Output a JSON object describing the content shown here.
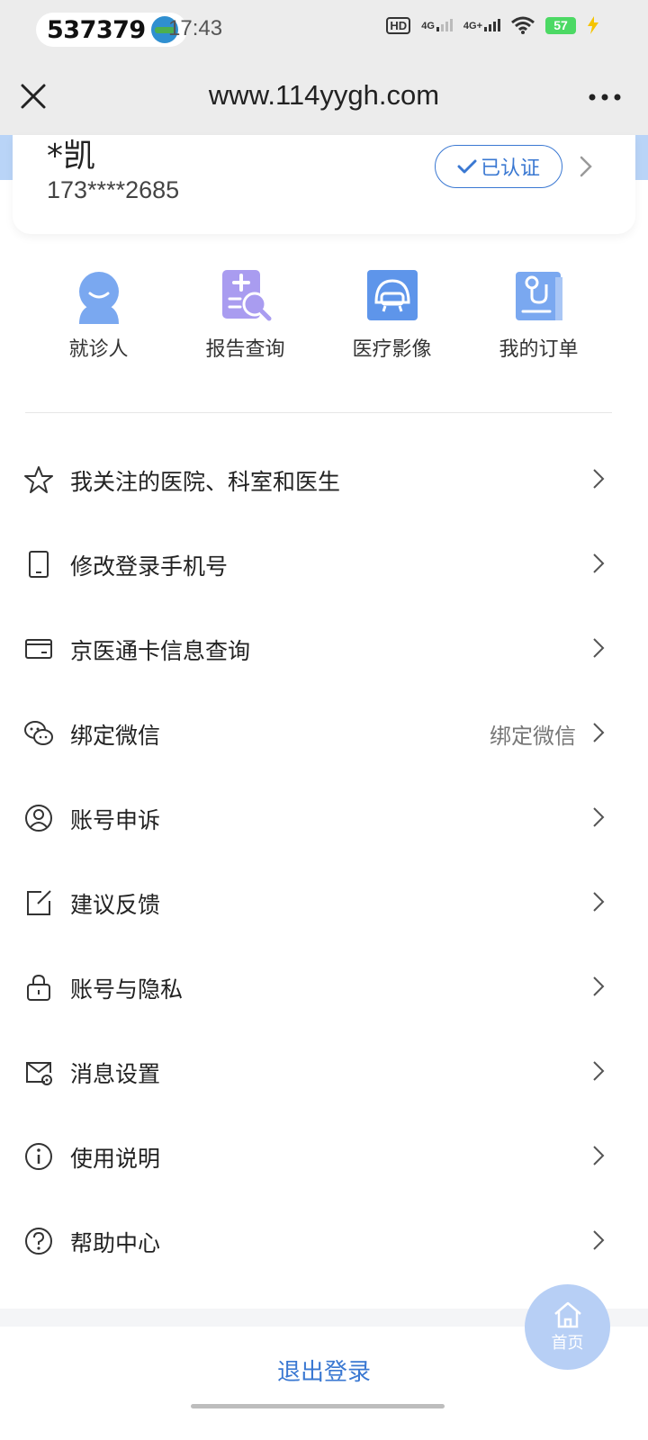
{
  "status_bar": {
    "code": "537379",
    "time": "17:43",
    "hd": "HD",
    "net1": "4G",
    "net2": "4G+",
    "battery": "57"
  },
  "browser": {
    "url": "www.114yygh.com",
    "close_icon": "close-icon",
    "more_icon": "more-icon"
  },
  "user": {
    "name": "*凯",
    "phone": "173****2685",
    "verified_label": "已认证"
  },
  "quick_actions": [
    {
      "label": "就诊人",
      "icon": "patient-icon"
    },
    {
      "label": "报告查询",
      "icon": "report-search-icon"
    },
    {
      "label": "医疗影像",
      "icon": "medical-imaging-icon"
    },
    {
      "label": "我的订单",
      "icon": "my-orders-icon"
    }
  ],
  "menu": [
    {
      "label": "我关注的医院、科室和医生",
      "icon": "star-icon",
      "value": ""
    },
    {
      "label": "修改登录手机号",
      "icon": "phone-icon",
      "value": ""
    },
    {
      "label": "京医通卡信息查询",
      "icon": "card-icon",
      "value": ""
    },
    {
      "label": "绑定微信",
      "icon": "wechat-icon",
      "value": "绑定微信"
    },
    {
      "label": "账号申诉",
      "icon": "user-circle-icon",
      "value": ""
    },
    {
      "label": "建议反馈",
      "icon": "edit-icon",
      "value": ""
    },
    {
      "label": "账号与隐私",
      "icon": "lock-icon",
      "value": ""
    },
    {
      "label": "消息设置",
      "icon": "mail-settings-icon",
      "value": ""
    },
    {
      "label": "使用说明",
      "icon": "info-icon",
      "value": ""
    },
    {
      "label": "帮助中心",
      "icon": "help-icon",
      "value": ""
    }
  ],
  "logout_label": "退出登录",
  "home_button_label": "首页",
  "colors": {
    "accent": "#3a78d2",
    "icon_blue": "#7aa8f0",
    "icon_purple": "#a99cf0",
    "bar_bg": "#ececec"
  }
}
